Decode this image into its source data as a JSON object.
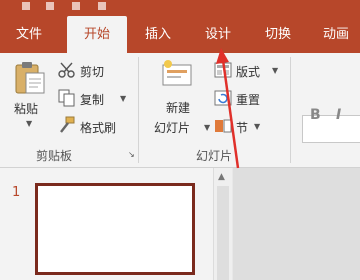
{
  "tabs": [
    {
      "label": "文件",
      "active": false
    },
    {
      "label": "开始",
      "active": true
    },
    {
      "label": "插入",
      "active": false
    },
    {
      "label": "设计",
      "active": false
    },
    {
      "label": "切换",
      "active": false
    },
    {
      "label": "动画",
      "active": false
    }
  ],
  "clipboard": {
    "paste_label": "粘贴",
    "cut_label": "剪切",
    "copy_label": "复制",
    "format_painter_label": "格式刷",
    "group_title": "剪贴板"
  },
  "slides_group": {
    "new_slide_label_line1": "新建",
    "new_slide_label_line2": "幻灯片",
    "layout_label": "版式",
    "reset_label": "重置",
    "section_label": "节",
    "group_title": "幻灯片"
  },
  "font_group": {
    "bold_label": "B",
    "italic_label": "I"
  },
  "thumbnails": [
    {
      "number": "1"
    }
  ],
  "colors": {
    "accent": "#b7472a",
    "annotation_arrow": "#e0302a"
  }
}
